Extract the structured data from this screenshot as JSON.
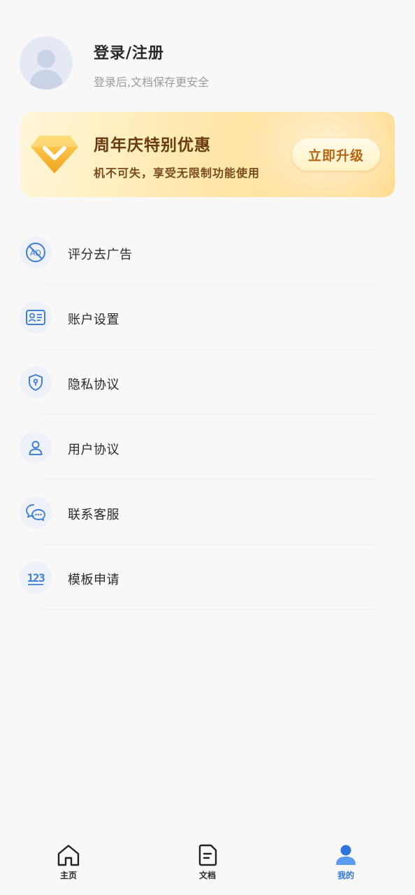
{
  "profile": {
    "title": "登录/注册",
    "subtitle": "登录后,文档保存更安全",
    "avatar_icon": "default-user-icon"
  },
  "promo": {
    "title": "周年庆特别优惠",
    "subtitle": "机不可失，享受无限制功能使用",
    "button_label": "立即升级",
    "icon": "vip-diamond-icon"
  },
  "menu": {
    "items": [
      {
        "label": "评分去广告",
        "icon": "no-ad-icon"
      },
      {
        "label": "账户设置",
        "icon": "id-card-icon"
      },
      {
        "label": "隐私协议",
        "icon": "shield-icon"
      },
      {
        "label": "用户协议",
        "icon": "user-icon"
      },
      {
        "label": "联系客服",
        "icon": "chat-icon"
      },
      {
        "label": "模板申请",
        "icon": "numbers-123-icon"
      }
    ]
  },
  "tabbar": {
    "tabs": [
      {
        "label": "主页",
        "icon": "home-icon",
        "active": false
      },
      {
        "label": "文档",
        "icon": "document-icon",
        "active": false
      },
      {
        "label": "我的",
        "icon": "profile-icon",
        "active": true
      }
    ]
  },
  "colors": {
    "accent": "#2f74de",
    "icon_blue": "#3f7fd6",
    "promo_text": "#6a3a10",
    "promo_button_text": "#b5650f"
  }
}
